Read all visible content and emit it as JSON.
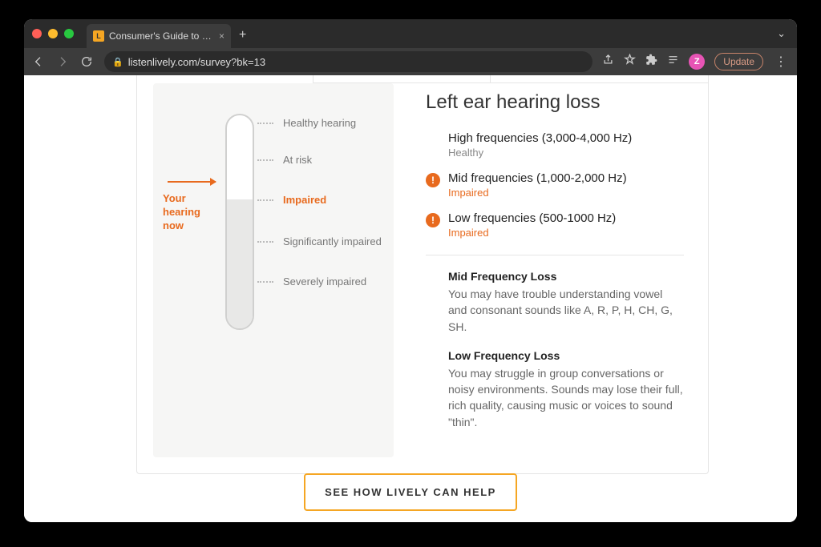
{
  "browser": {
    "tab_title": "Consumer's Guide to Hearing A",
    "favicon_letter": "L",
    "url": "listenlively.com/survey?bk=13",
    "update_label": "Update",
    "avatar_letter": "Z"
  },
  "gauge": {
    "pointer_label": "Your hearing now",
    "levels": [
      {
        "label": "Healthy hearing",
        "current": false
      },
      {
        "label": "At risk",
        "current": false
      },
      {
        "label": "Impaired",
        "current": true
      },
      {
        "label": "Significantly impaired",
        "current": false
      },
      {
        "label": "Severely impaired",
        "current": false
      }
    ]
  },
  "results": {
    "title": "Left ear hearing loss",
    "frequencies": [
      {
        "title": "High frequencies (3,000-4,000 Hz)",
        "status": "Healthy",
        "impaired": false
      },
      {
        "title": "Mid frequencies (1,000-2,000 Hz)",
        "status": "Impaired",
        "impaired": true
      },
      {
        "title": "Low frequencies (500-1000 Hz)",
        "status": "Impaired",
        "impaired": true
      }
    ],
    "details": [
      {
        "heading": "Mid Frequency Loss",
        "body": "You may have trouble understanding vowel and consonant sounds like A, R, P, H, CH, G, SH."
      },
      {
        "heading": "Low Frequency Loss",
        "body": "You may struggle in group conversations or noisy environments. Sounds may lose their full, rich quality, causing music or voices to sound \"thin\"."
      }
    ]
  },
  "cta_label": "SEE HOW LIVELY CAN HELP"
}
